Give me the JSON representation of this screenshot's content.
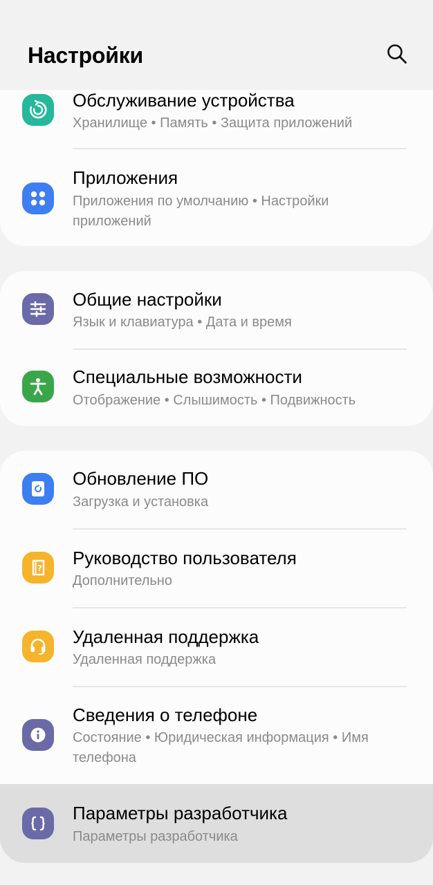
{
  "header": {
    "title": "Настройки",
    "search_icon": "search-icon"
  },
  "items": [
    {
      "id": "device-care",
      "title": "Обслуживание устройства",
      "subtitle": "Хранилище • Память • Защита приложений",
      "icon": "device-care-icon",
      "color": "#25b89a"
    },
    {
      "id": "apps",
      "title": "Приложения",
      "subtitle": "Приложения по умолчанию • Настройки приложений",
      "icon": "apps-icon",
      "color": "#3d7ef1"
    },
    {
      "id": "general-management",
      "title": "Общие настройки",
      "subtitle": "Язык и клавиатура • Дата и время",
      "icon": "sliders-icon",
      "color": "#6b6aa8"
    },
    {
      "id": "accessibility",
      "title": "Специальные возможности",
      "subtitle": "Отображение • Слышимость • Подвижность",
      "icon": "accessibility-icon",
      "color": "#3aa64a"
    },
    {
      "id": "software-update",
      "title": "Обновление ПО",
      "subtitle": "Загрузка и установка",
      "icon": "software-update-icon",
      "color": "#3d7ef1"
    },
    {
      "id": "user-manual",
      "title": "Руководство пользователя",
      "subtitle": "Дополнительно",
      "icon": "user-manual-icon",
      "color": "#f5b42b"
    },
    {
      "id": "remote-support",
      "title": "Удаленная поддержка",
      "subtitle": "Удаленная поддержка",
      "icon": "headset-icon",
      "color": "#f5b42b"
    },
    {
      "id": "about-phone",
      "title": "Сведения о телефоне",
      "subtitle": "Состояние • Юридическая информация • Имя телефона",
      "icon": "info-icon",
      "color": "#6b6aa8"
    },
    {
      "id": "developer-options",
      "title": "Параметры разработчика",
      "subtitle": "Параметры разработчика",
      "icon": "braces-icon",
      "color": "#6b6aa8"
    }
  ]
}
